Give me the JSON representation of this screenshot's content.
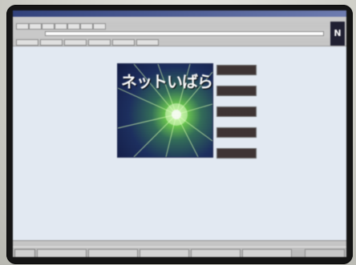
{
  "colors": {
    "wall": "#cfcfc8",
    "bezel": "#151515",
    "screen_bg": "#e5ecf6",
    "banner_dark": "#172a5c",
    "banner_glow": "#6fd24a",
    "nav_button": "#3a2f2f"
  },
  "browser": {
    "logo_letter": "N"
  },
  "page": {
    "banner_title": "ネットいばらき",
    "nav_items": [
      "",
      "",
      "",
      "",
      ""
    ]
  }
}
